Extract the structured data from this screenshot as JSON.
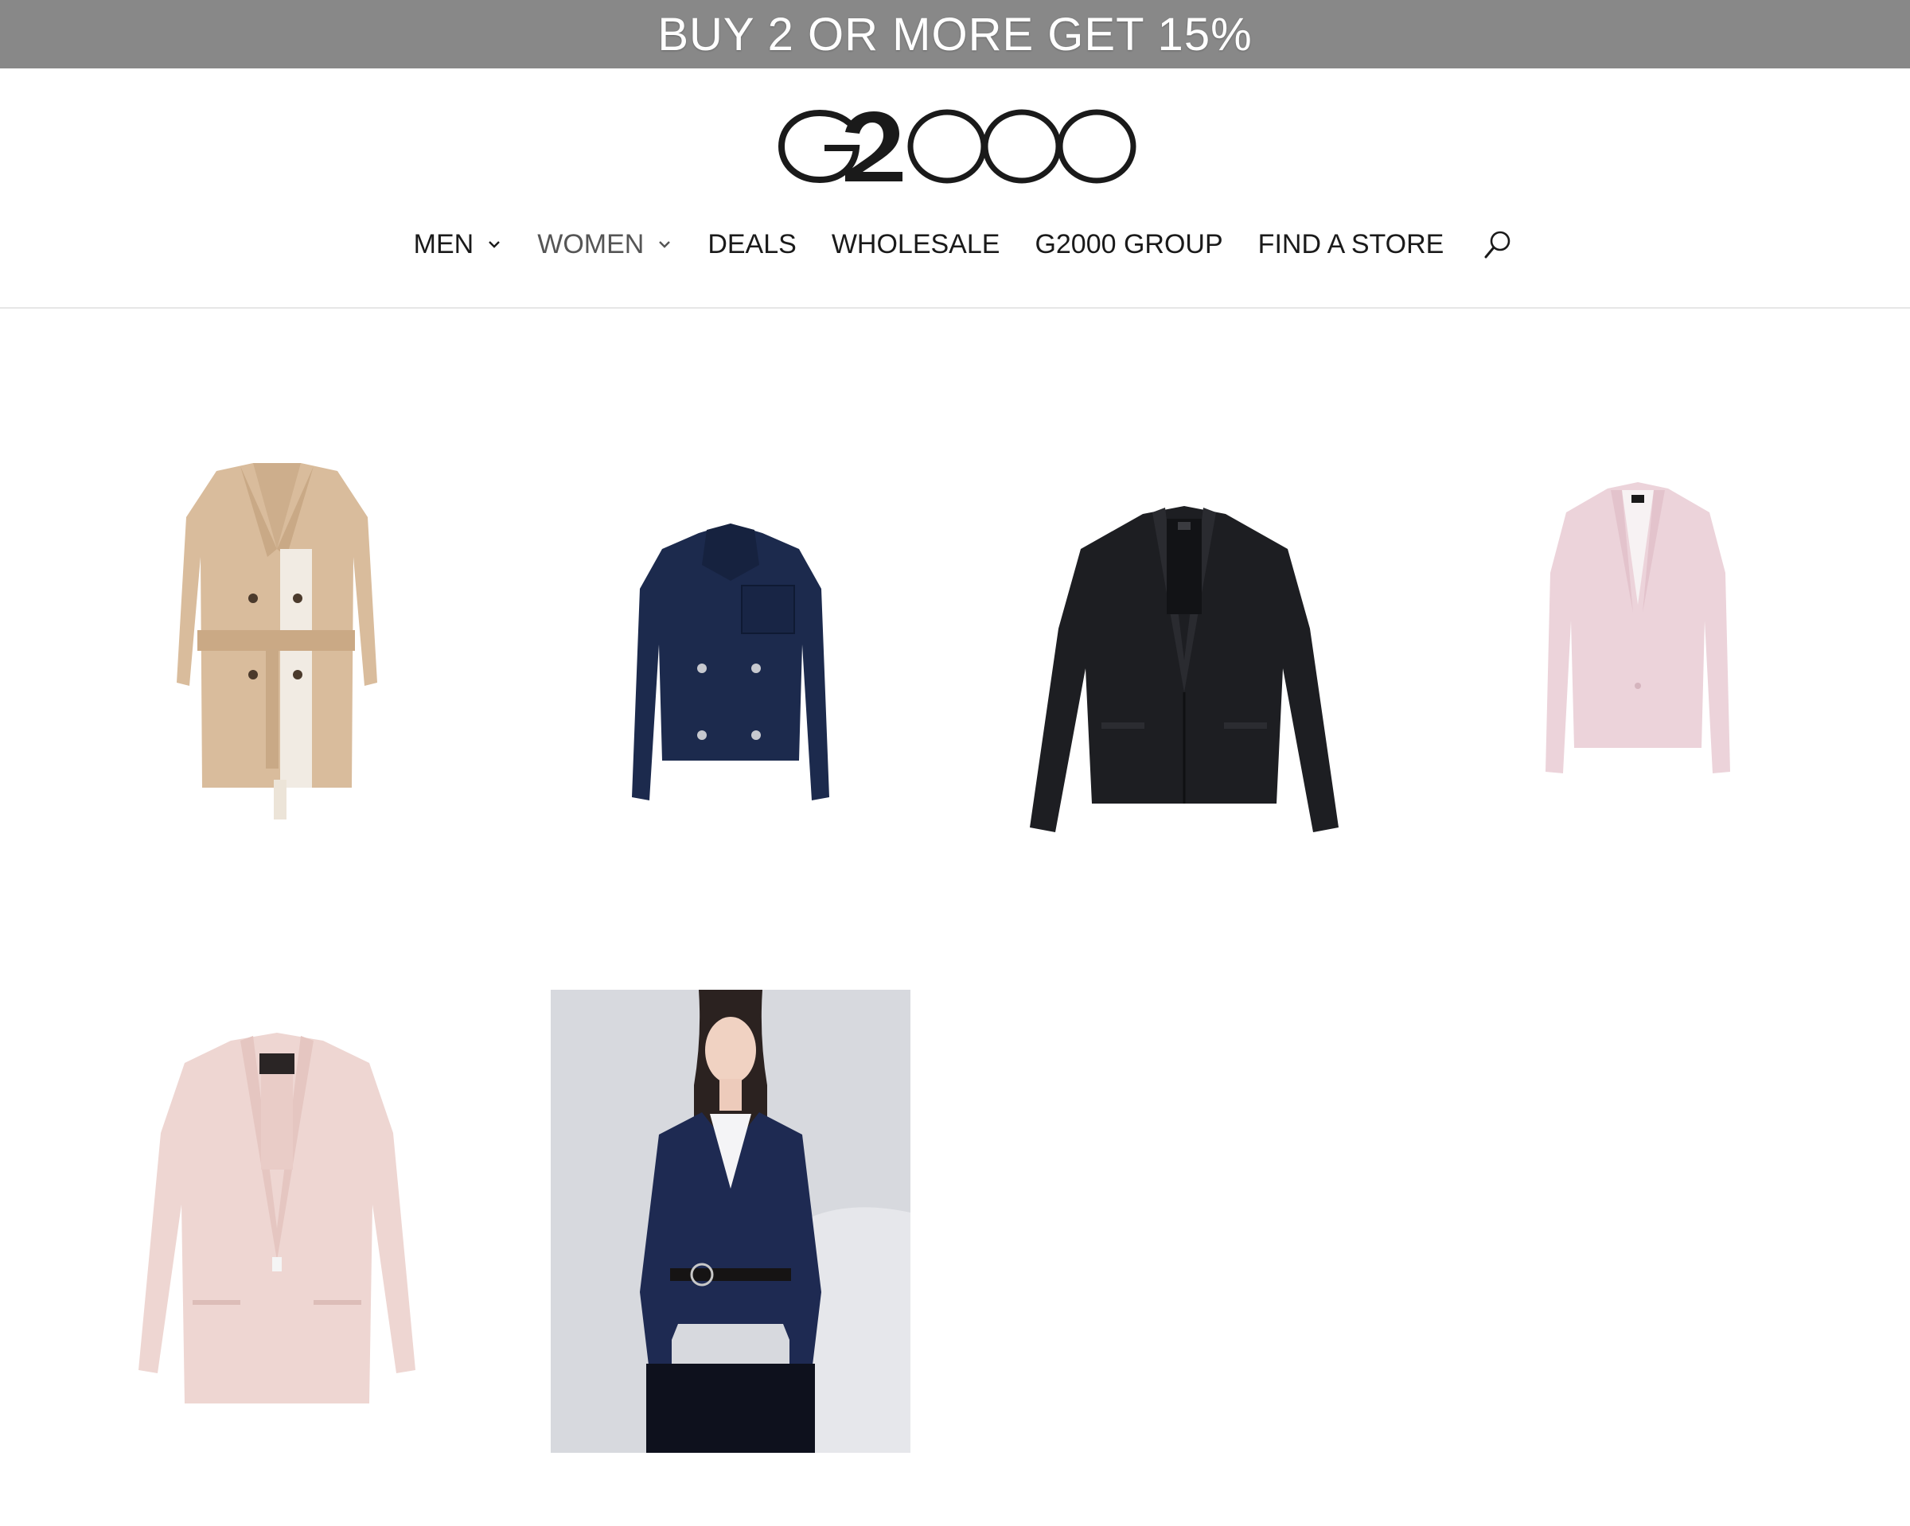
{
  "promo": {
    "text": "BUY 2 OR MORE GET 15%"
  },
  "header": {
    "logo_text": "G2000",
    "nav": [
      {
        "label": "MEN",
        "has_dropdown": true
      },
      {
        "label": "WOMEN",
        "has_dropdown": true,
        "active": true
      },
      {
        "label": "DEALS"
      },
      {
        "label": "WHOLESALE"
      },
      {
        "label": "G2000 GROUP"
      },
      {
        "label": "FIND A STORE"
      }
    ],
    "search_icon": "search-icon"
  },
  "products": [
    {
      "item": "beige belted trench coat",
      "color": "#d9bc9c"
    },
    {
      "item": "navy double-breasted short jacket",
      "color": "#1c2a4d"
    },
    {
      "item": "black blazer",
      "color": "#1d1e22"
    },
    {
      "item": "light pink blazer",
      "color": "#ecd3da"
    },
    {
      "item": "blush pink blazer",
      "color": "#eed6d2"
    },
    {
      "item": "model wearing navy pinstripe blazer with belt",
      "color": "#1e2a52"
    }
  ],
  "colors": {
    "promo_bg": "#888888",
    "promo_text": "#ffffff",
    "nav_text": "#1a1a1a",
    "nav_active": "#555555"
  }
}
